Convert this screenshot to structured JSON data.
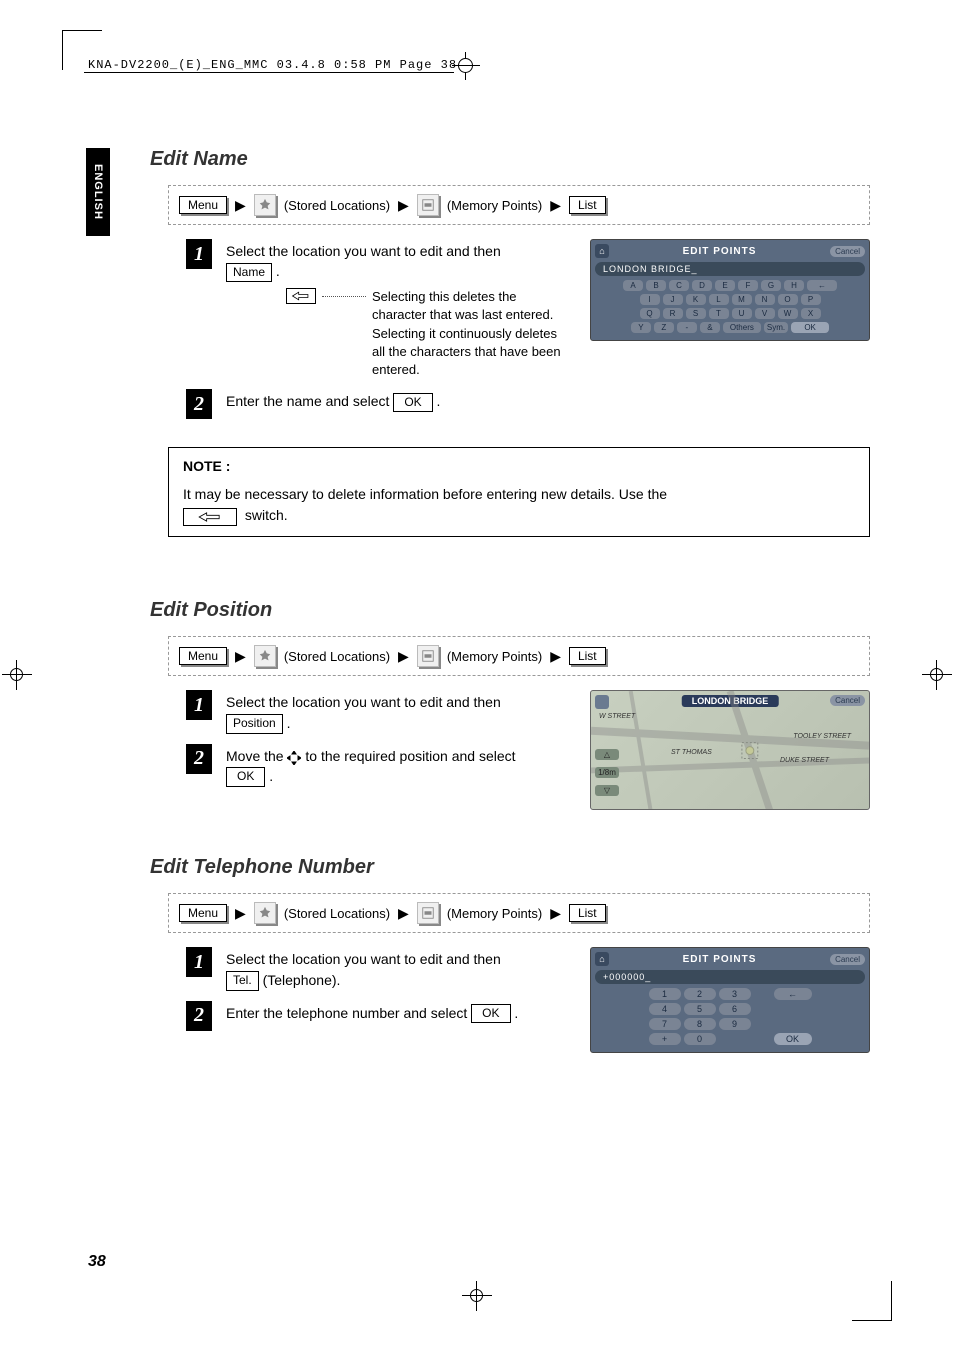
{
  "header": {
    "imprint": "KNA-DV2200_(E)_ENG_MMC  03.4.8  0:58 PM  Page 38"
  },
  "side_tab": "ENGLISH",
  "page_number": "38",
  "sections": {
    "edit_name": {
      "title": "Edit Name",
      "breadcrumb": {
        "menu": "Menu",
        "stored": "(Stored Locations)",
        "memory": "(Memory Points)",
        "list": "List"
      },
      "step1": {
        "num": "1",
        "text_a": "Select the location you want to edit and then ",
        "name_btn": "Name",
        "period": " .",
        "note": "Selecting this deletes the character that was last entered. Selecting it continuously deletes all the characters that have been entered."
      },
      "step2": {
        "num": "2",
        "text": "Enter the name and select ",
        "ok": "OK",
        "period": " ."
      },
      "note_box": {
        "label": "NOTE :",
        "text_a": "It may be necessary to delete information before entering new details.  Use the ",
        "text_b": " switch."
      },
      "screenshot": {
        "title": "EDIT POINTS",
        "cancel": "Cancel",
        "input": "LONDON BRIDGE_",
        "rows": [
          [
            "A",
            "B",
            "C",
            "D",
            "E",
            "F",
            "G",
            "H"
          ],
          [
            "I",
            "J",
            "K",
            "L",
            "M",
            "N",
            "O",
            "P"
          ],
          [
            "Q",
            "R",
            "S",
            "T",
            "U",
            "V",
            "W",
            "X"
          ]
        ],
        "bottom": {
          "y": "Y",
          "z": "Z",
          "hy": "-",
          "amp": "&",
          "others": "Others",
          "sym": "Sym.",
          "ok": "OK"
        },
        "back": "←"
      }
    },
    "edit_position": {
      "title": "Edit Position",
      "breadcrumb": {
        "menu": "Menu",
        "stored": "(Stored Locations)",
        "memory": "(Memory Points)",
        "list": "List"
      },
      "step1": {
        "num": "1",
        "text": "Select the location you want to edit and then ",
        "btn": "Position",
        "period": " ."
      },
      "step2": {
        "num": "2",
        "text_a": "Move the ",
        "text_b": " to the required position and select ",
        "ok": "OK",
        "period": " ."
      },
      "screenshot": {
        "title": "LONDON BRIDGE",
        "cancel": "Cancel",
        "scale": "1/8m",
        "s1": "W STREET",
        "s2": "TOOLEY STREET",
        "s3": "DUKE STREET",
        "s4": "ST THOMAS"
      }
    },
    "edit_tel": {
      "title": "Edit Telephone Number",
      "breadcrumb": {
        "menu": "Menu",
        "stored": "(Stored Locations)",
        "memory": "(Memory Points)",
        "list": "List"
      },
      "step1": {
        "num": "1",
        "text": "Select the location you want to edit and then ",
        "btn": "Tel.",
        "suffix": " (Telephone)."
      },
      "step2": {
        "num": "2",
        "text": "Enter the telephone number and select ",
        "ok": "OK",
        "period": " ."
      },
      "screenshot": {
        "title": "EDIT POINTS",
        "cancel": "Cancel",
        "input": "+000000_",
        "keys": [
          "1",
          "2",
          "3",
          "4",
          "5",
          "6",
          "7",
          "8",
          "9",
          "+",
          "0"
        ],
        "back": "←",
        "ok": "OK"
      }
    }
  }
}
